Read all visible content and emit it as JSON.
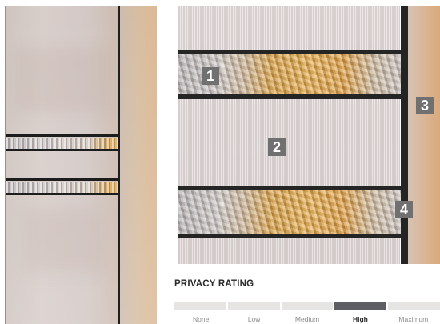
{
  "callouts": {
    "one": "1",
    "two": "2",
    "three": "3",
    "four": "4"
  },
  "privacy": {
    "title": "PRIVACY RATING",
    "levels": [
      "None",
      "Low",
      "Medium",
      "High",
      "Maximum"
    ],
    "selected": "High",
    "selected_index": 3,
    "active_color": "#5b5f64",
    "inactive_color": "#e7e5e3"
  }
}
